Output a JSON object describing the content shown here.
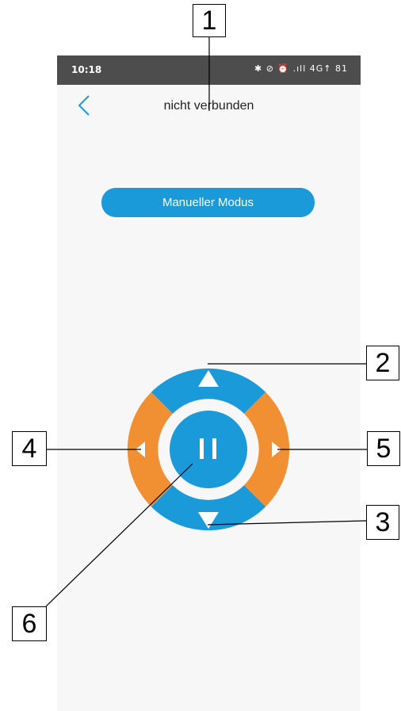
{
  "status_bar": {
    "time": "10:18",
    "icons_text": "✱ ⊘ ⏰ .ıll 4G↑ 81",
    "icons": [
      "bluetooth-icon",
      "notification-mute-icon",
      "alarm-icon",
      "signal-icon",
      "battery-icon"
    ]
  },
  "header": {
    "title": "nicht verbunden",
    "back_icon": "chevron-left-icon"
  },
  "mode_button": {
    "label": "Manueller Modus"
  },
  "dpad": {
    "colors": {
      "vertical": "#1a9ad9",
      "horizontal": "#f18f33",
      "center": "#1a9ad9"
    },
    "buttons": [
      "up",
      "down",
      "left",
      "right",
      "pause"
    ]
  },
  "callouts": {
    "c1": "1",
    "c2": "2",
    "c3": "3",
    "c4": "4",
    "c5": "5",
    "c6": "6"
  }
}
